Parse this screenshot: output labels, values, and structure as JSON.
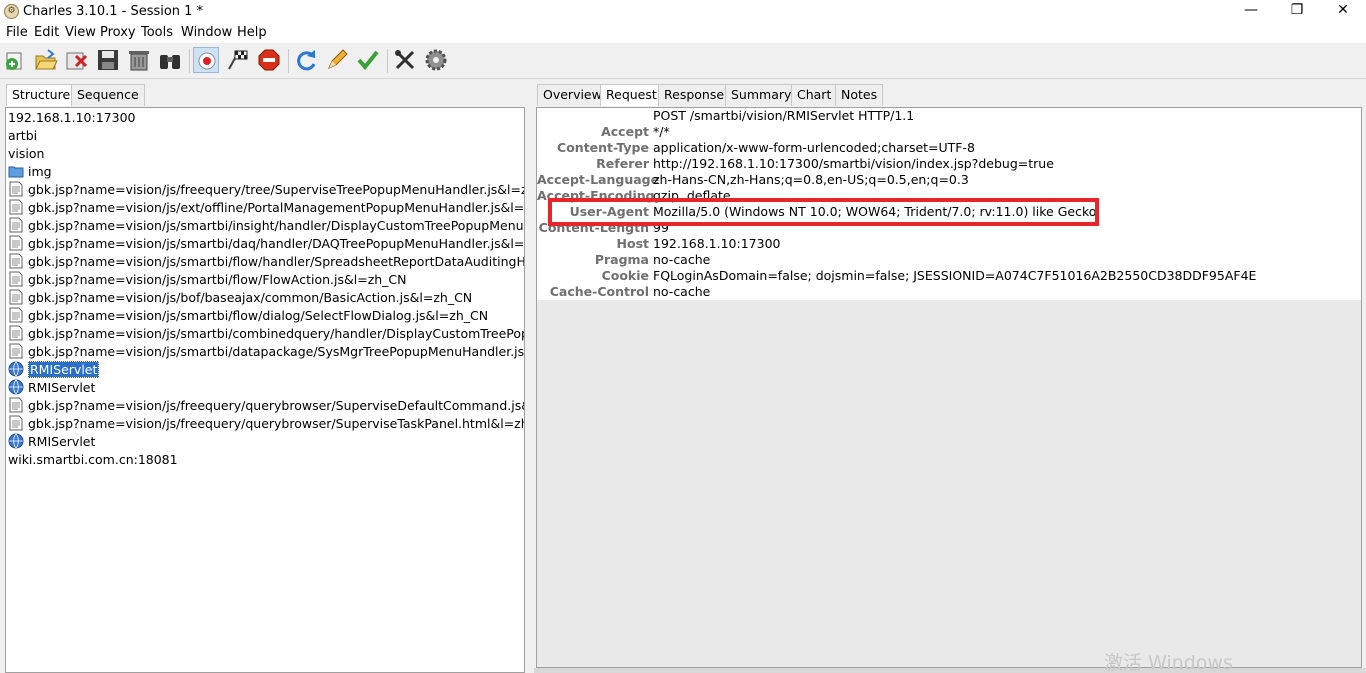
{
  "window": {
    "title": "Charles 3.10.1 - Session 1 *",
    "min_glyph": "—",
    "max_glyph": "❐",
    "close_glyph": "✕"
  },
  "menu": [
    "File",
    "Edit",
    "View",
    "Proxy",
    "Tools",
    "Window",
    "Help"
  ],
  "toolbar": {
    "icons": [
      "new-session-icon",
      "open-session-icon",
      "close-session-icon",
      "save-icon",
      "clear-icon",
      "find-icon",
      "record-icon",
      "throttle-icon",
      "breakpoints-icon",
      "repeat-icon",
      "edit-icon",
      "validate-icon",
      "tools-icon",
      "settings-icon"
    ]
  },
  "left": {
    "tabs": [
      "Structure",
      "Sequence"
    ],
    "tree": [
      {
        "label": "192.168.1.10:17300",
        "icon": "none"
      },
      {
        "label": "artbi",
        "icon": "none"
      },
      {
        "label": "vision",
        "icon": "none"
      },
      {
        "label": "img",
        "icon": "folder"
      },
      {
        "label": "gbk.jsp?name=vision/js/freequery/tree/SuperviseTreePopupMenuHandler.js&l=zh_CN",
        "icon": "doc"
      },
      {
        "label": "gbk.jsp?name=vision/js/ext/offline/PortalManagementPopupMenuHandler.js&l=zh_CN",
        "icon": "doc"
      },
      {
        "label": "gbk.jsp?name=vision/js/smartbi/insight/handler/DisplayCustomTreePopupMenuHandler.js&l=zh_CN",
        "icon": "doc"
      },
      {
        "label": "gbk.jsp?name=vision/js/smartbi/daq/handler/DAQTreePopupMenuHandler.js&l=zh_CN",
        "icon": "doc"
      },
      {
        "label": "gbk.jsp?name=vision/js/smartbi/flow/handler/SpreadsheetReportDataAuditingHandler.js&l=zh_CN",
        "icon": "doc"
      },
      {
        "label": "gbk.jsp?name=vision/js/smartbi/flow/FlowAction.js&l=zh_CN",
        "icon": "doc"
      },
      {
        "label": "gbk.jsp?name=vision/js/bof/baseajax/common/BasicAction.js&l=zh_CN",
        "icon": "doc"
      },
      {
        "label": "gbk.jsp?name=vision/js/smartbi/flow/dialog/SelectFlowDialog.js&l=zh_CN",
        "icon": "doc"
      },
      {
        "label": "gbk.jsp?name=vision/js/smartbi/combinedquery/handler/DisplayCustomTreePopupMenuHandler.js&l=zh_CN",
        "icon": "doc"
      },
      {
        "label": "gbk.jsp?name=vision/js/smartbi/datapackage/SysMgrTreePopupMenuHandler.js&l=zh_CN",
        "icon": "doc"
      },
      {
        "label": "RMIServlet",
        "icon": "globe",
        "selected": true
      },
      {
        "label": "RMIServlet",
        "icon": "globe"
      },
      {
        "label": "gbk.jsp?name=vision/js/freequery/querybrowser/SuperviseDefaultCommand.js&l=zh_CN",
        "icon": "doc"
      },
      {
        "label": "gbk.jsp?name=vision/js/freequery/querybrowser/SuperviseTaskPanel.html&l=zh_CN",
        "icon": "doc"
      },
      {
        "label": "RMIServlet",
        "icon": "globe"
      },
      {
        "label": "wiki.smartbi.com.cn:18081",
        "icon": "none"
      }
    ]
  },
  "right": {
    "tabs": [
      "Overview",
      "Request",
      "Response",
      "Summary",
      "Chart",
      "Notes"
    ],
    "selected_tab": "Request",
    "headers": [
      {
        "key": "",
        "value": "POST /smartbi/vision/RMIServlet HTTP/1.1"
      },
      {
        "key": "Accept",
        "value": "*/*"
      },
      {
        "key": "Content-Type",
        "value": "application/x-www-form-urlencoded;charset=UTF-8"
      },
      {
        "key": "Referer",
        "value": "http://192.168.1.10:17300/smartbi/vision/index.jsp?debug=true"
      },
      {
        "key": "Accept-Language",
        "value": "zh-Hans-CN,zh-Hans;q=0.8,en-US;q=0.5,en;q=0.3"
      },
      {
        "key": "Accept-Encoding",
        "value": "gzip, deflate"
      },
      {
        "key": "User-Agent",
        "value": "Mozilla/5.0 (Windows NT 10.0; WOW64; Trident/7.0; rv:11.0) like Gecko"
      },
      {
        "key": "Content-Length",
        "value": "99"
      },
      {
        "key": "Host",
        "value": "192.168.1.10:17300"
      },
      {
        "key": "Pragma",
        "value": "no-cache"
      },
      {
        "key": "Cookie",
        "value": "FQLoginAsDomain=false; dojsmin=false; JSESSIONID=A074C7F51016A2B2550CD38DDF95AF4E"
      },
      {
        "key": "Cache-Control",
        "value": "no-cache"
      }
    ],
    "highlight_color": "#e8262a"
  },
  "watermark": "激活 Windows"
}
